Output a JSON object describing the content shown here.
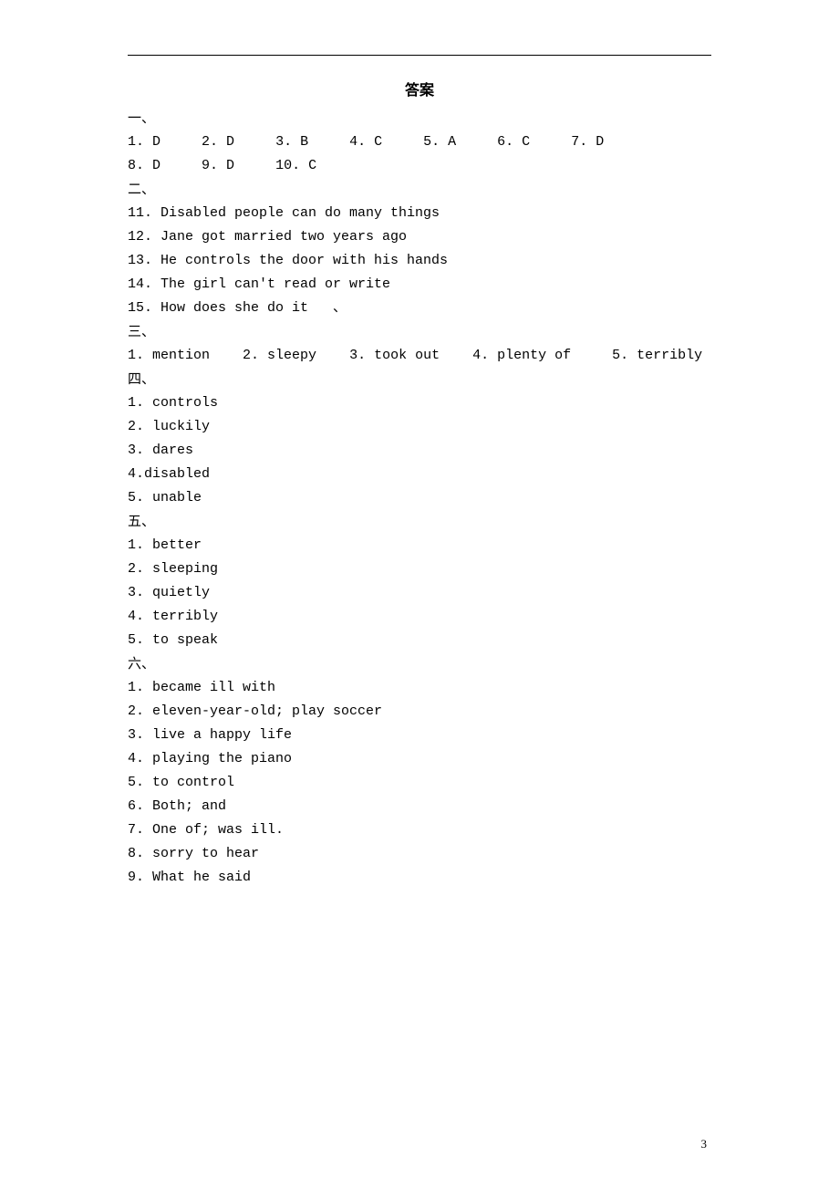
{
  "title": "答案",
  "page_number": "3",
  "section1": {
    "head": "一、",
    "row1": [
      "1. D",
      "2. D",
      "3. B",
      "4. C",
      "5. A",
      "6. C",
      "7. D"
    ],
    "row2": [
      "8. D",
      "9. D",
      "10. C"
    ]
  },
  "section2": {
    "head": "二、",
    "items": [
      "11. Disabled people can do many things",
      "12. Jane got married two years ago",
      "13. He controls the door with his hands",
      "14. The girl can't read or write",
      "15. How does she do it   、"
    ]
  },
  "section3": {
    "head": "三、",
    "row": [
      "1. mention",
      "2. sleepy",
      "3. took out",
      "4. plenty of",
      "5. terribly"
    ]
  },
  "section4": {
    "head": "四、",
    "items": [
      "1. controls",
      "2. luckily",
      "3. dares",
      "4.disabled",
      "5. unable"
    ]
  },
  "section5": {
    "head": "五、",
    "items": [
      "1. better",
      "2. sleeping",
      "3. quietly",
      "4. terribly",
      "5. to speak"
    ]
  },
  "section6": {
    "head": "六、",
    "items": [
      "1. became ill with",
      "2. eleven-year-old; play soccer",
      "3. live a happy life",
      "4. playing the piano",
      "5. to control",
      "6. Both; and",
      "7. One of; was ill.",
      "8. sorry to hear",
      "9. What he said"
    ]
  }
}
